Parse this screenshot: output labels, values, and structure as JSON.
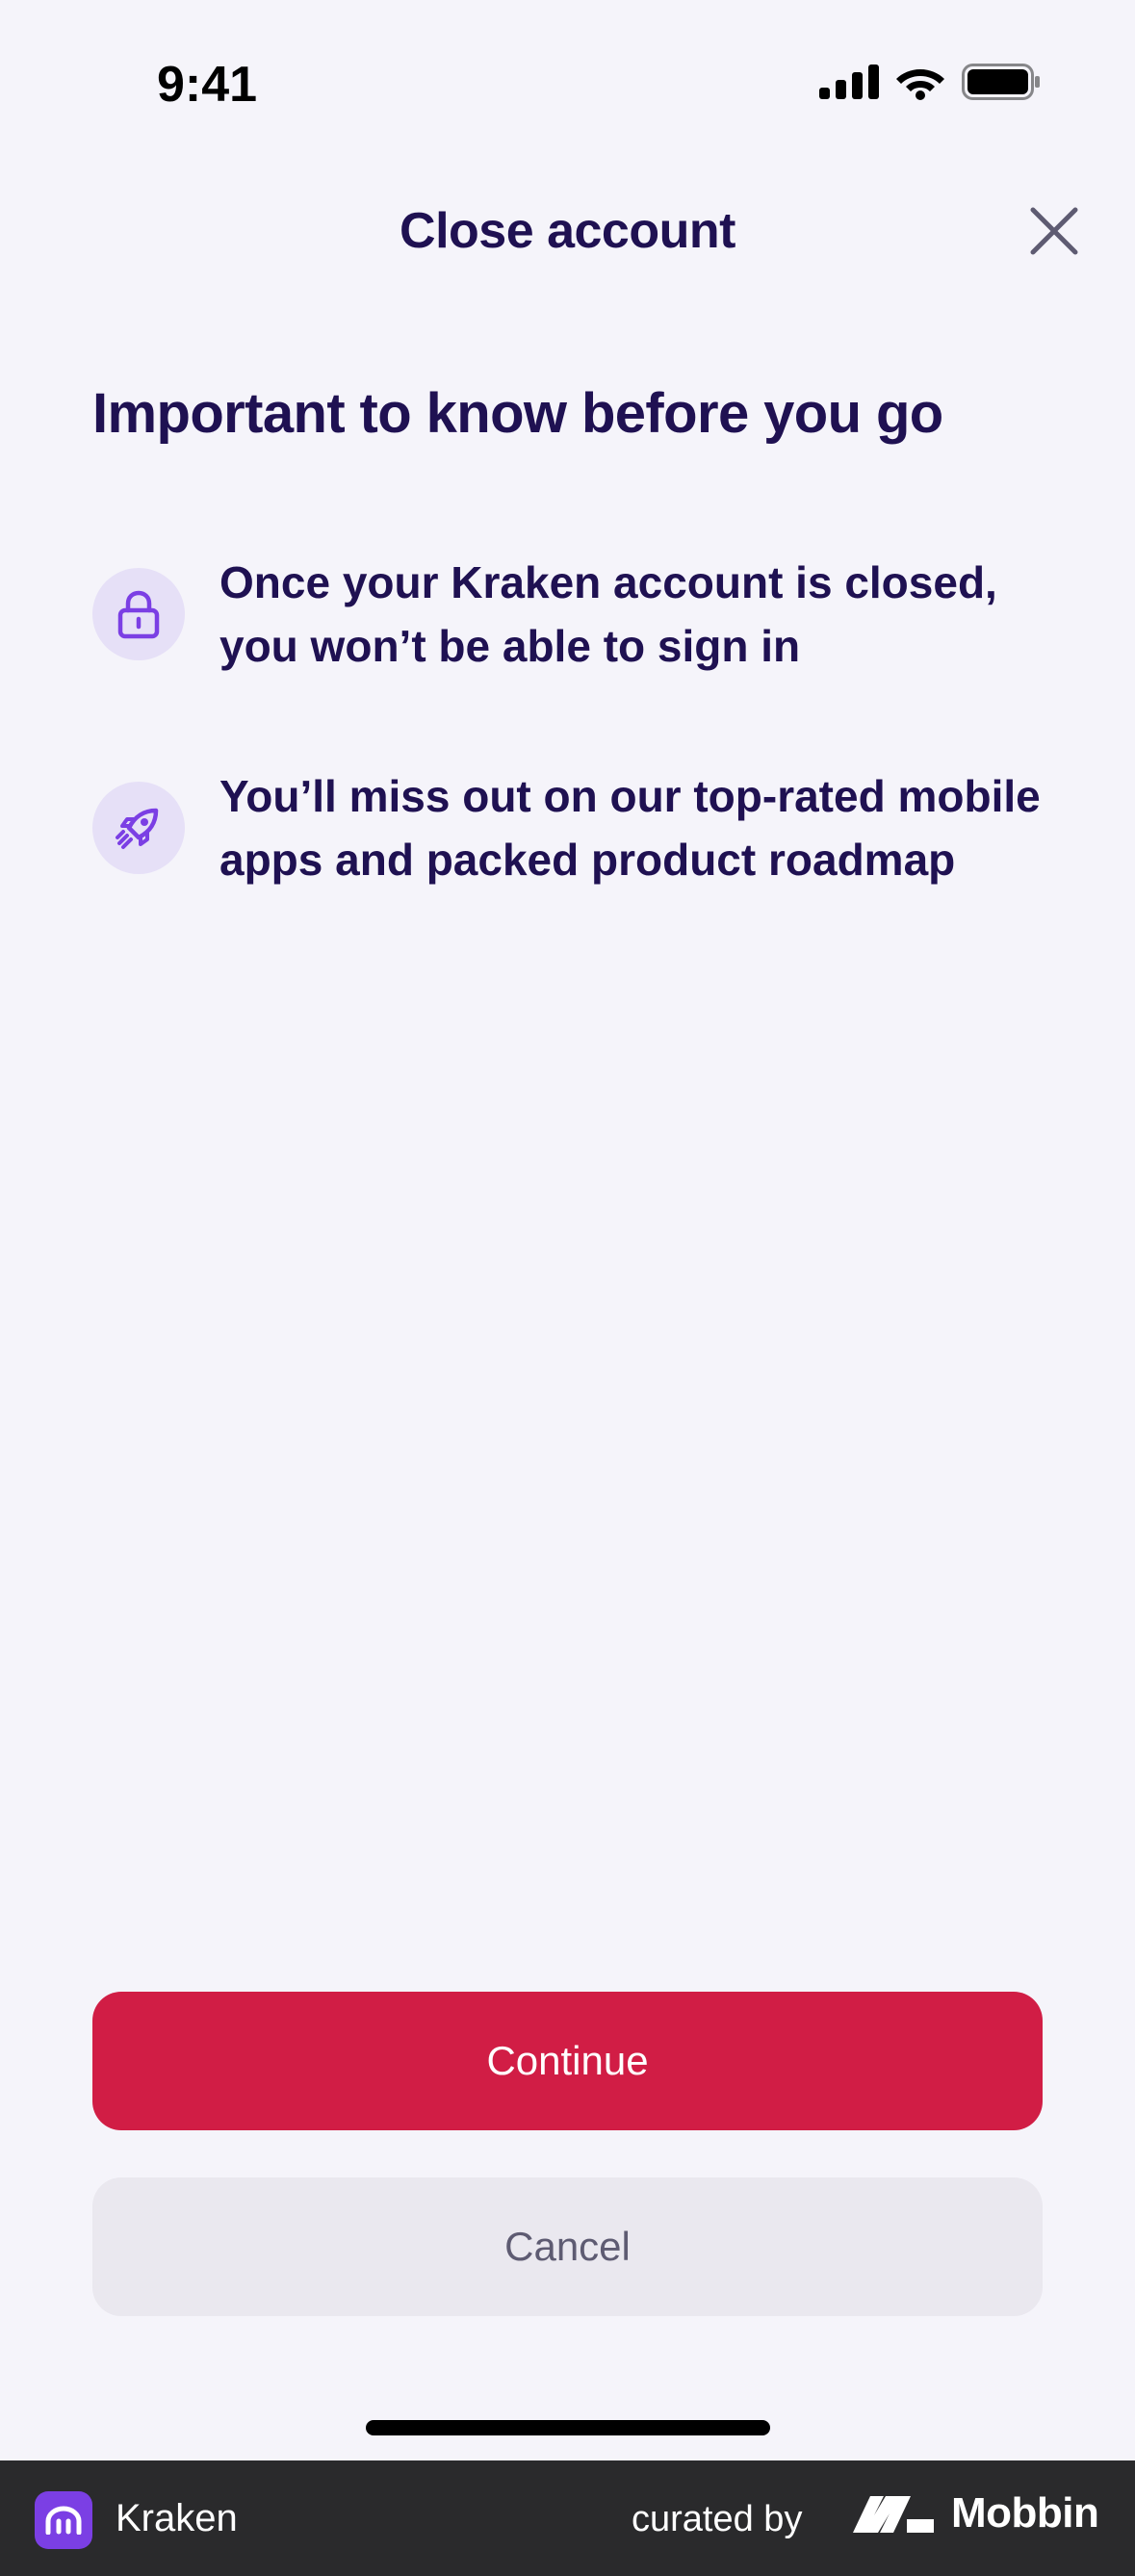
{
  "status_bar": {
    "time": "9:41"
  },
  "header": {
    "title": "Close account"
  },
  "main": {
    "heading": "Important to know before you go",
    "items": [
      {
        "icon": "lock-icon",
        "text": "Once your Kraken account is closed, you won’t be able to sign in"
      },
      {
        "icon": "rocket-icon",
        "text": "You’ll miss out on our top-rated mobile apps and packed product roadmap"
      }
    ]
  },
  "actions": {
    "continue_label": "Continue",
    "cancel_label": "Cancel"
  },
  "footer": {
    "app_name": "Kraken",
    "curated_by": "curated by",
    "brand": "Mobbin"
  },
  "colors": {
    "background": "#f5f4fa",
    "text_primary": "#1f1152",
    "accent_purple": "#7b3fe4",
    "icon_circle": "#e6e0f7",
    "danger": "#d11d45",
    "secondary_button": "#eae8ef",
    "footer_bg": "#2a2a2c"
  }
}
